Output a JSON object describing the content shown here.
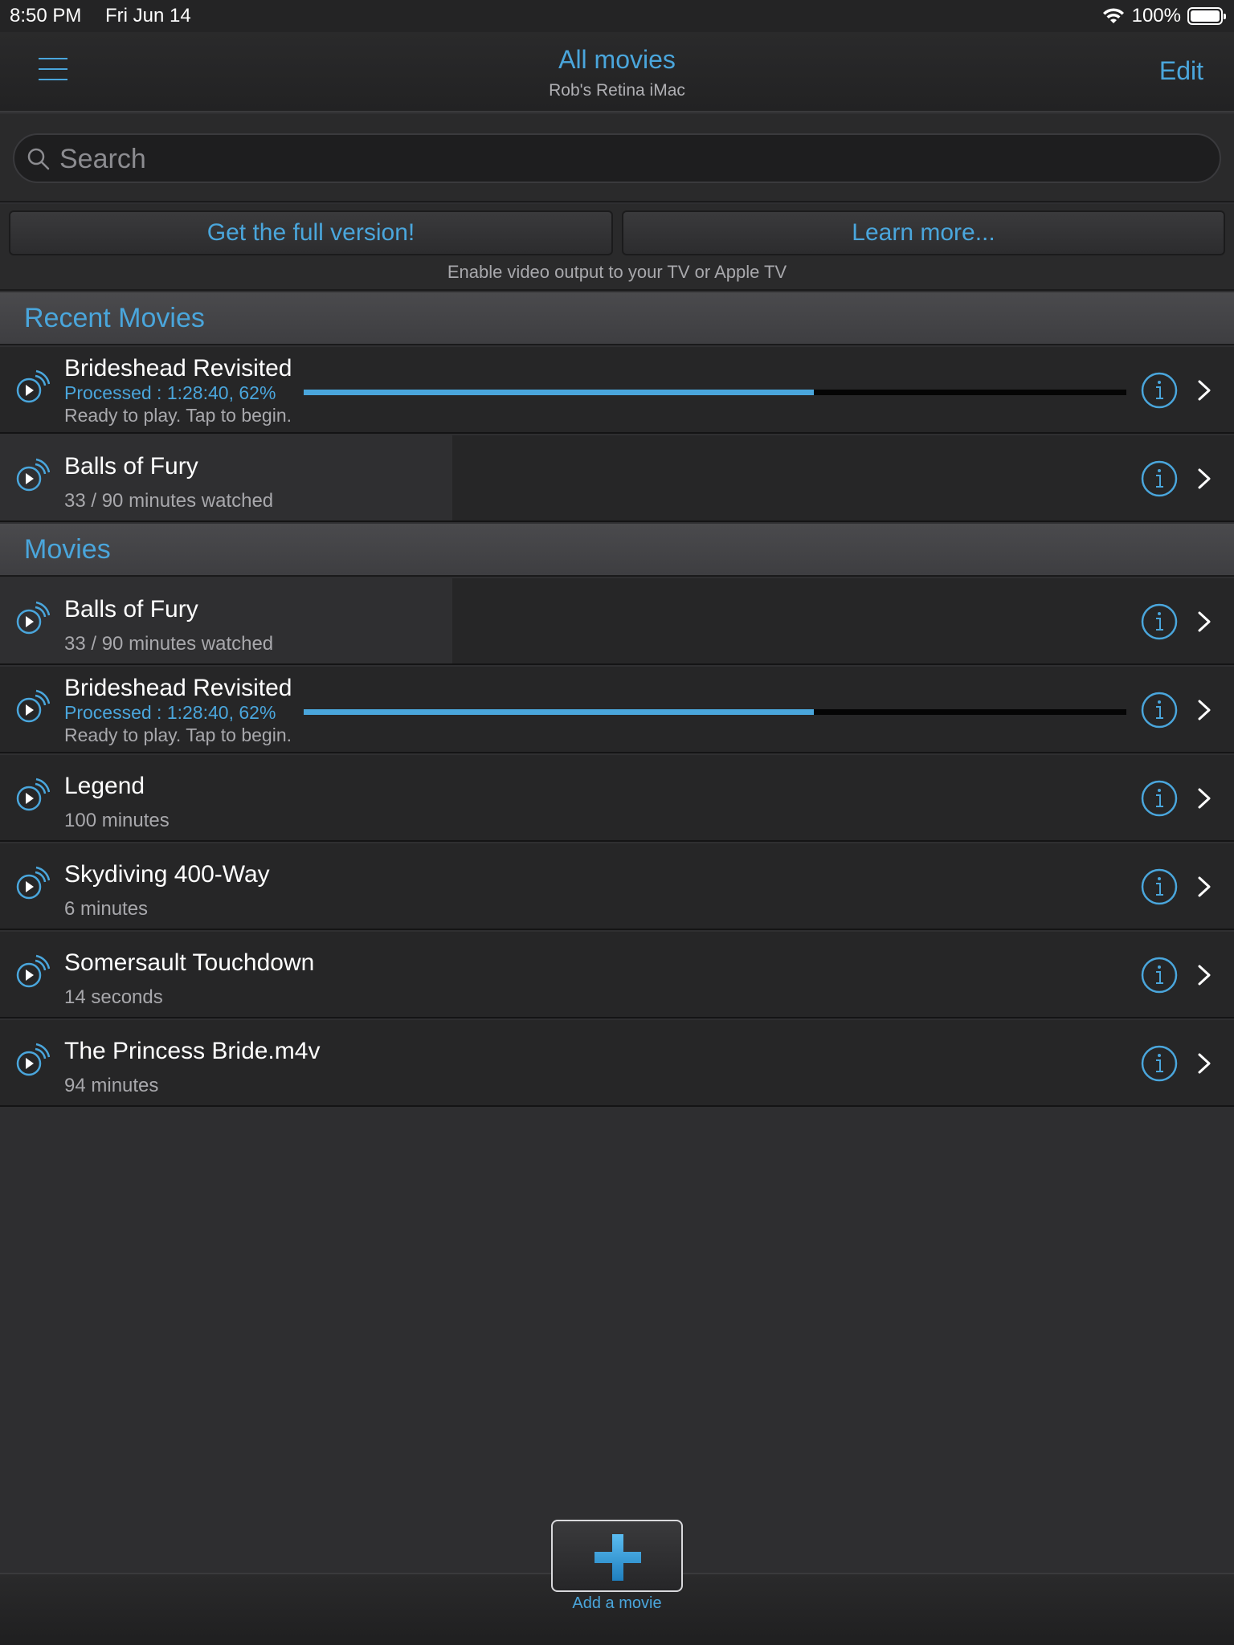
{
  "status_bar": {
    "time": "8:50 PM",
    "date": "Fri Jun 14",
    "battery": "100%"
  },
  "nav": {
    "title": "All movies",
    "subtitle": "Rob's Retina iMac",
    "edit_label": "Edit"
  },
  "search": {
    "placeholder": "Search",
    "value": ""
  },
  "promo": {
    "full_version_label": "Get the full version!",
    "learn_more_label": "Learn more...",
    "note": "Enable video output to your TV or Apple TV"
  },
  "sections": {
    "recent": "Recent Movies",
    "movies": "Movies"
  },
  "recent_items": [
    {
      "title": "Brideshead Revisited",
      "processed": "Processed : 1:28:40, 62%",
      "progress": 0.62,
      "status": "Ready to play. Tap to begin."
    },
    {
      "title": "Balls of Fury",
      "subtitle": "33 / 90 minutes watched",
      "watched_fraction": 0.3667
    }
  ],
  "movie_items": [
    {
      "title": "Balls of Fury",
      "subtitle": "33 / 90 minutes watched",
      "watched_fraction": 0.3667
    },
    {
      "title": "Brideshead Revisited",
      "processed": "Processed : 1:28:40, 62%",
      "progress": 0.62,
      "status": "Ready to play. Tap to begin."
    },
    {
      "title": "Legend",
      "subtitle": "100 minutes"
    },
    {
      "title": "Skydiving 400-Way",
      "subtitle": "6 minutes"
    },
    {
      "title": "Somersault Touchdown",
      "subtitle": "14 seconds"
    },
    {
      "title": "The Princess Bride.m4v",
      "subtitle": "94 minutes"
    }
  ],
  "toolbar": {
    "add_label": "Add a movie"
  },
  "colors": {
    "accent": "#4aa6dc",
    "background": "#262627",
    "section": "#444447"
  }
}
